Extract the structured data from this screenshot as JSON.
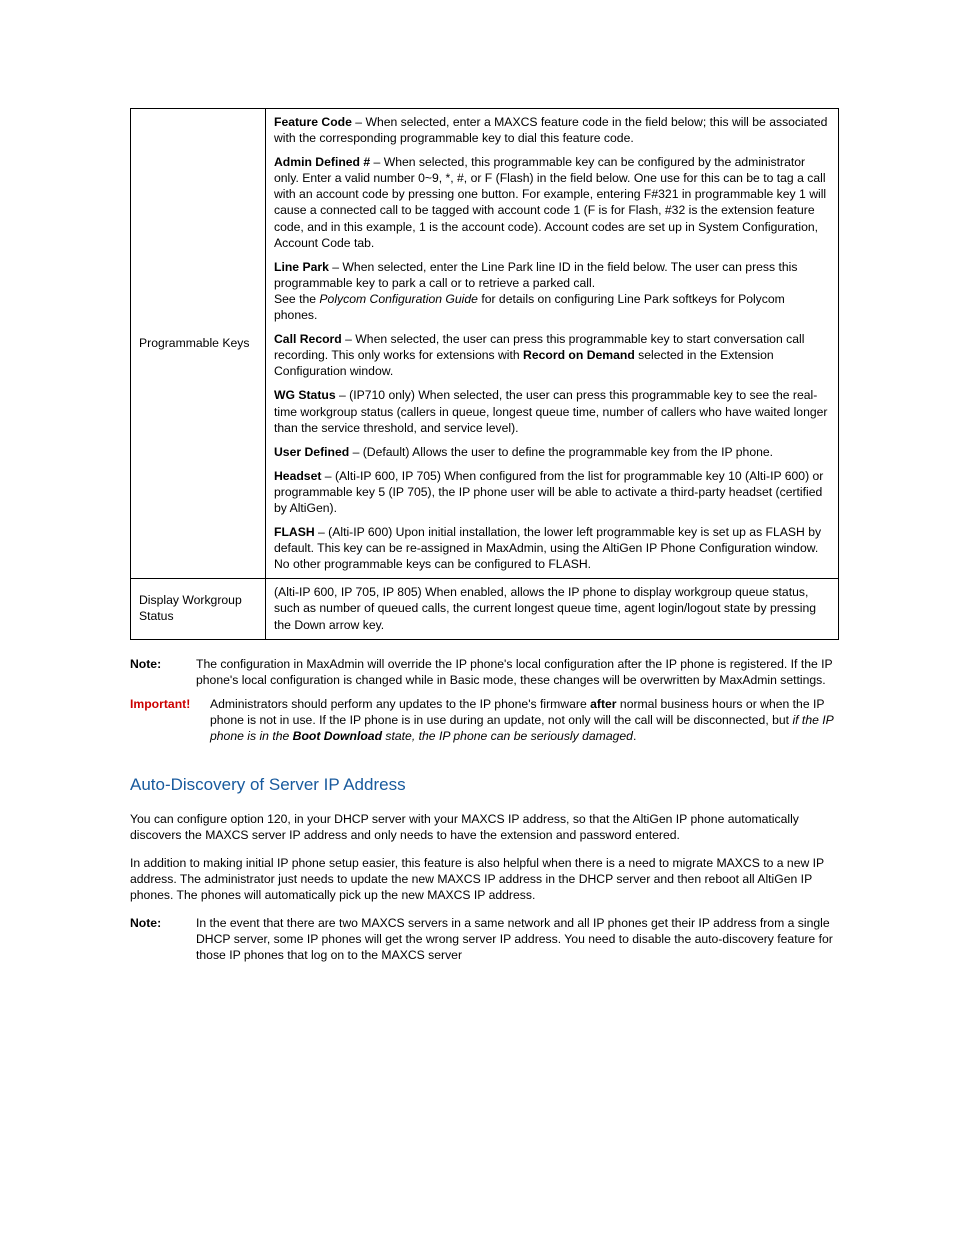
{
  "table": {
    "row1_label": "Programmable Keys",
    "features": {
      "featureCode": {
        "title": "Feature Code",
        "text": " – When selected, enter a MAXCS feature code in the field below; this will be associated with the corresponding programmable key to dial this feature code."
      },
      "admin": {
        "title": "Admin Defined #",
        "text": " – When selected, this programmable key can be configured by the administrator only. Enter a valid number 0~9, *, #, or F (Flash) in the field below. One use for this can be to tag a call with an account code by pressing one button. For example, entering F#321 in programmable key 1 will cause a connected call to be tagged with account code 1 (F is for Flash, #32 is the extension feature code, and in this example, 1 is the account code). Account codes are set up in System Configuration, Account Code tab."
      },
      "linePark": {
        "title": "Line Park",
        "text": " – When selected, enter the Line Park line ID in the field below. The user can press this programmable key to park a call or to retrieve a parked call.",
        "lead": "See the ",
        "doc": "Polycom Configuration Guide",
        "tail": " for details on configuring Line Park softkeys for Polycom phones."
      },
      "callRecord": {
        "title": "Call Record",
        "text_a": " – When selected, the user can press this programmable key to start conversation call recording. This only works for extensions with ",
        "opt": "Record on Demand",
        "text_b": " selected in the Extension Configuration window."
      },
      "wgStatus": {
        "title": "WG Status",
        "text": " – (IP710 only) When selected, the user can press this programmable key to see the real-time workgroup status (callers in queue, longest queue time, number of callers who have waited longer than the service threshold, and service level)."
      },
      "userDef": {
        "title": "User Defined",
        "text": " – (Default) Allows the user to define the programmable key from the IP phone."
      },
      "headset": {
        "title": "Headset",
        "text": " – (Alti-IP 600, IP 705) When configured from the list for programmable key 10 (Alti-IP 600) or programmable key 5 (IP 705), the IP phone user will be able to activate a third-party headset (certified by AltiGen)."
      },
      "flash": {
        "title": "FLASH",
        "text": " – (Alti-IP 600) Upon initial installation, the lower left programmable key is set up as FLASH by default. This key can be re-assigned in MaxAdmin, using the AltiGen IP Phone Configuration window. No other programmable keys can be configured to FLASH."
      }
    },
    "row2_label": "Display Workgroup Status",
    "row2_text": "(Alti-IP 600, IP 705, IP 805) When enabled, allows the IP phone to display workgroup queue status, such as number of queued calls, the current longest queue time, agent login/logout state by pressing the Down arrow key."
  },
  "notes": {
    "label": "Note:",
    "note_text": "The configuration in MaxAdmin will override the IP phone's local configuration after the IP phone is registered. If the IP phone's local configuration is changed while in Basic mode, these changes will be overwritten by MaxAdmin settings.",
    "imp_label": "Important!",
    "imp_a": "Administrators should perform any updates to the IP phone's firmware ",
    "imp_after": "after",
    "imp_b": " normal business hours or when the IP phone is not in use. If the IP phone is in use during an update, not only will the call will be disconnected, but ",
    "imp_em": "if the IP phone is in the ",
    "imp_state": "Boot Download",
    "imp_em2": " state, the IP phone can be seriously damaged",
    "imp_c": "."
  },
  "heading": "Auto-Discovery of Server IP Address",
  "p1": "You can configure option 120, in your DHCP server with your MAXCS IP address, so that the AltiGen IP phone automatically discovers the MAXCS server IP address and only needs to have the extension and password entered.",
  "p2": "In addition to making initial IP phone setup easier, this feature is also helpful when there is a need to migrate MAXCS to a new IP address. The administrator just needs to update the new MAXCS IP address in the DHCP server and then reboot all AltiGen IP phones. The phones will automatically pick up the new MAXCS IP address.",
  "note2_label": "Note:",
  "note2_text": "In the event that there are two MAXCS servers in a same network and all IP phones get their IP address from a single DHCP server, some IP phones will get the wrong server IP address. You need to disable the auto-discovery feature for those IP phones that log on to the MAXCS server"
}
